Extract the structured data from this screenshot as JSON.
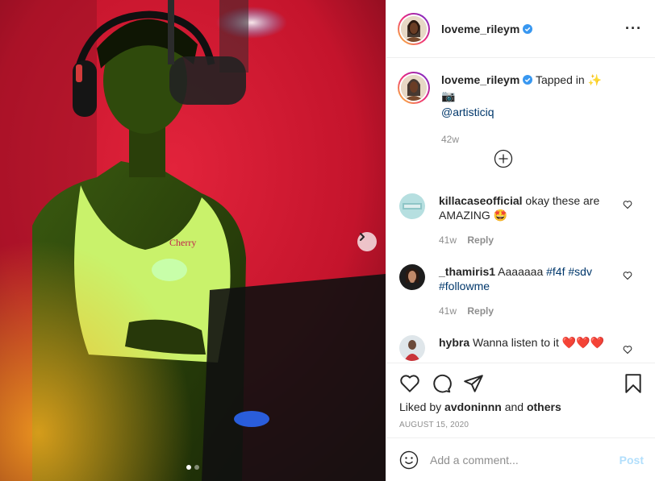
{
  "post": {
    "username": "loveme_rileym",
    "caption_text": "Tapped in ✨ 📷",
    "caption_mention": "@artisticiq",
    "caption_time": "42w"
  },
  "comments": [
    {
      "username": "killacaseofficial",
      "text": "okay these are AMAZING 🤩",
      "time": "41w",
      "reply": "Reply"
    },
    {
      "username": "_thamiris1",
      "text_prefix": "Aaaaaaa",
      "hashtags": "#f4f #sdv #followme",
      "time": "41w",
      "reply": "Reply"
    },
    {
      "username": "hybra",
      "text": "Wanna listen to it ❤️❤️❤️"
    }
  ],
  "likes": {
    "prefix": "Liked by",
    "user": "avdoninnn",
    "conj": "and",
    "others": "others"
  },
  "date": "AUGUST 15, 2020",
  "add_comment": {
    "placeholder": "Add a comment...",
    "post_label": "Post"
  },
  "icons": [
    "more-options-icon",
    "verified-icon",
    "load-more-icon",
    "heart-icon",
    "comment-icon",
    "share-icon",
    "save-icon",
    "emoji-icon",
    "next-arrow-icon"
  ],
  "colors": {
    "verified": "#3897f0",
    "link": "#00376b",
    "post_disabled": "#b2dffc",
    "like_heart": "#ed4956"
  },
  "carousel": {
    "current": 1,
    "total": 2
  }
}
